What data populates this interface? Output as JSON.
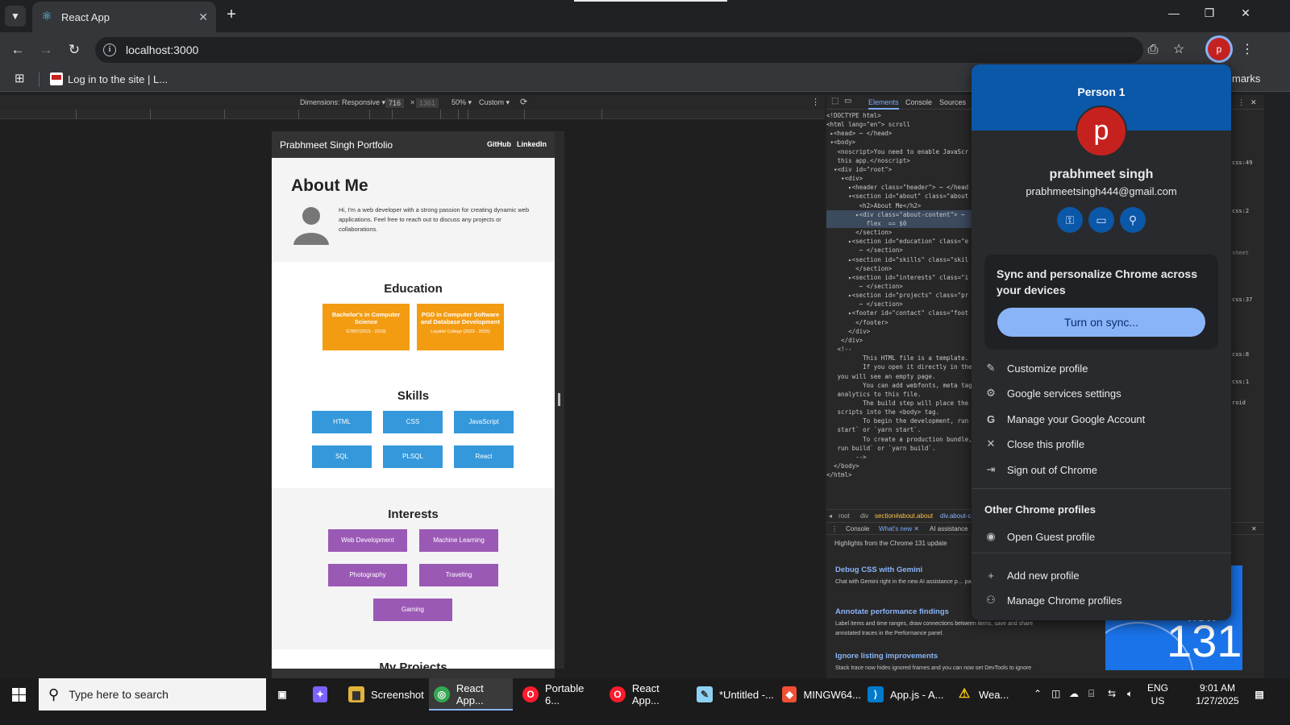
{
  "browser": {
    "tab_title": "React App",
    "url": "localhost:3000",
    "bookmark": "Log in to the site | L...",
    "bookmarks_right": "marks"
  },
  "device_toolbar": {
    "dimensions": "Dimensions: Responsive ▾",
    "width": "716",
    "times": "×",
    "height": "1361",
    "zoom": "50% ▾",
    "throttle": "Custom ▾"
  },
  "site": {
    "title": "Prabhmeet Singh Portfolio",
    "nav": [
      "GitHub",
      "LinkedIn"
    ],
    "about_heading": "About Me",
    "about_text": "Hi, I'm a web developer with a strong passion for creating dynamic web applications. Feel free to reach out to discuss any projects or collaborations.",
    "education_heading": "Education",
    "education": [
      {
        "degree": "Bachelor's in Computer Science",
        "school": "GTBIT(2015 - 2019)"
      },
      {
        "degree": "PGD in Computer Software and Database Development",
        "school": "Loyalist College (2023 - 2025)"
      }
    ],
    "skills_heading": "Skills",
    "skills": [
      "HTML",
      "CSS",
      "JavaScript",
      "SQL",
      "PLSQL",
      "React"
    ],
    "interests_heading": "Interests",
    "interests": [
      "Web Development",
      "Machine Learning",
      "Photography",
      "Traveling",
      "Gaming"
    ],
    "projects_heading": "My Projects"
  },
  "devtools": {
    "tabs": [
      "Elements",
      "Console",
      "Sources"
    ],
    "dom_lines": [
      "<!DOCTYPE html>",
      "<html lang=\"en\"> scroll",
      " ▸<head> ⋯ </head>",
      " ▾<body>",
      "   <noscript>You need to enable JavaScr",
      "   this app.</noscript>",
      "  ▾<div id=\"root\">",
      "    ▾<div>",
      "      ▸<header class=\"header\"> ⋯ </head",
      "      ▾<section id=\"about\" class=\"about",
      "         <h2>About Me</h2>",
      "        ▸<div class=\"about-content\"> ⋯",
      "           flex  == $0",
      "        </section>",
      "      ▸<section id=\"education\" class=\"e",
      "         ⋯ </section>",
      "      ▸<section id=\"skills\" class=\"skil",
      "        </section>",
      "      ▸<section id=\"interests\" class=\"i",
      "         ⋯ </section>",
      "      ▸<section id=\"projects\" class=\"pr",
      "         ⋯ </section>",
      "      ▸<footer id=\"contact\" class=\"foot",
      "        </footer>",
      "      </div>",
      "    </div>",
      "   <!--",
      "          This HTML file is a template.",
      "          If you open it directly in the",
      "   you will see an empty page.",
      "",
      "          You can add webfonts, meta tag",
      "   analytics to this file.",
      "          The build step will place the",
      "   scripts into the <body> tag.",
      "",
      "          To begin the development, run",
      "   start` or `yarn start`.",
      "          To create a production bundle,",
      "   run build` or `yarn build`.",
      "        -->",
      "  </body>",
      "</html>"
    ],
    "crumbs": [
      "◂",
      "root",
      "div",
      "section#about.about",
      "div.about-c"
    ],
    "right_strip": [
      "css:49",
      "css:2",
      "sheet",
      "css:37",
      "css:8",
      "css:1",
      "roid"
    ],
    "drawer_tabs": [
      "Console",
      "What's new ✕",
      "AI assistance"
    ],
    "drawer_subtitle": "Highlights from the Chrome 131 update",
    "news": [
      {
        "title": "Debug CSS with Gemini",
        "text": "Chat with Gemini right in the new AI assistance p… page."
      },
      {
        "title": "Annotate performance findings",
        "text": "Label items and time ranges, draw connections between items, save and share annotated traces in the Performance panel."
      },
      {
        "title": "Ignore listing improvements",
        "text": "Stack trace now hides ignored frames and you can now set DevTools to ignore"
      }
    ],
    "news_image": {
      "new": "new",
      "num": "131"
    }
  },
  "profile_menu": {
    "person": "Person 1",
    "avatar_letter": "p",
    "name": "prabhmeet singh",
    "email": "prabhmeetsingh444@gmail.com",
    "sync_text": "Sync and personalize Chrome across your devices",
    "sync_button": "Turn on sync...",
    "items": [
      "Customize profile",
      "Google services settings",
      "Manage your Google Account",
      "Close this profile",
      "Sign out of Chrome"
    ],
    "other_heading": "Other Chrome profiles",
    "guest": "Open Guest profile",
    "add": "Add new profile",
    "manage": "Manage Chrome profiles"
  },
  "taskbar": {
    "search_placeholder": "Type here to search",
    "apps": [
      "Screenshot",
      "React App...",
      "Portable 6...",
      "React App...",
      "*Untitled -...",
      "MINGW64...",
      "App.js - A...",
      "Wea..."
    ],
    "lang": "ENG",
    "region": "US",
    "time": "9:01 AM",
    "date": "1/27/2025"
  },
  "colors": {
    "accent": "#8ab4f8",
    "education_card": "#f39c12",
    "skill_button": "#3498db",
    "interest_button": "#9b59b6",
    "profile_banner": "#0b57a8",
    "avatar": "#c5221f"
  }
}
